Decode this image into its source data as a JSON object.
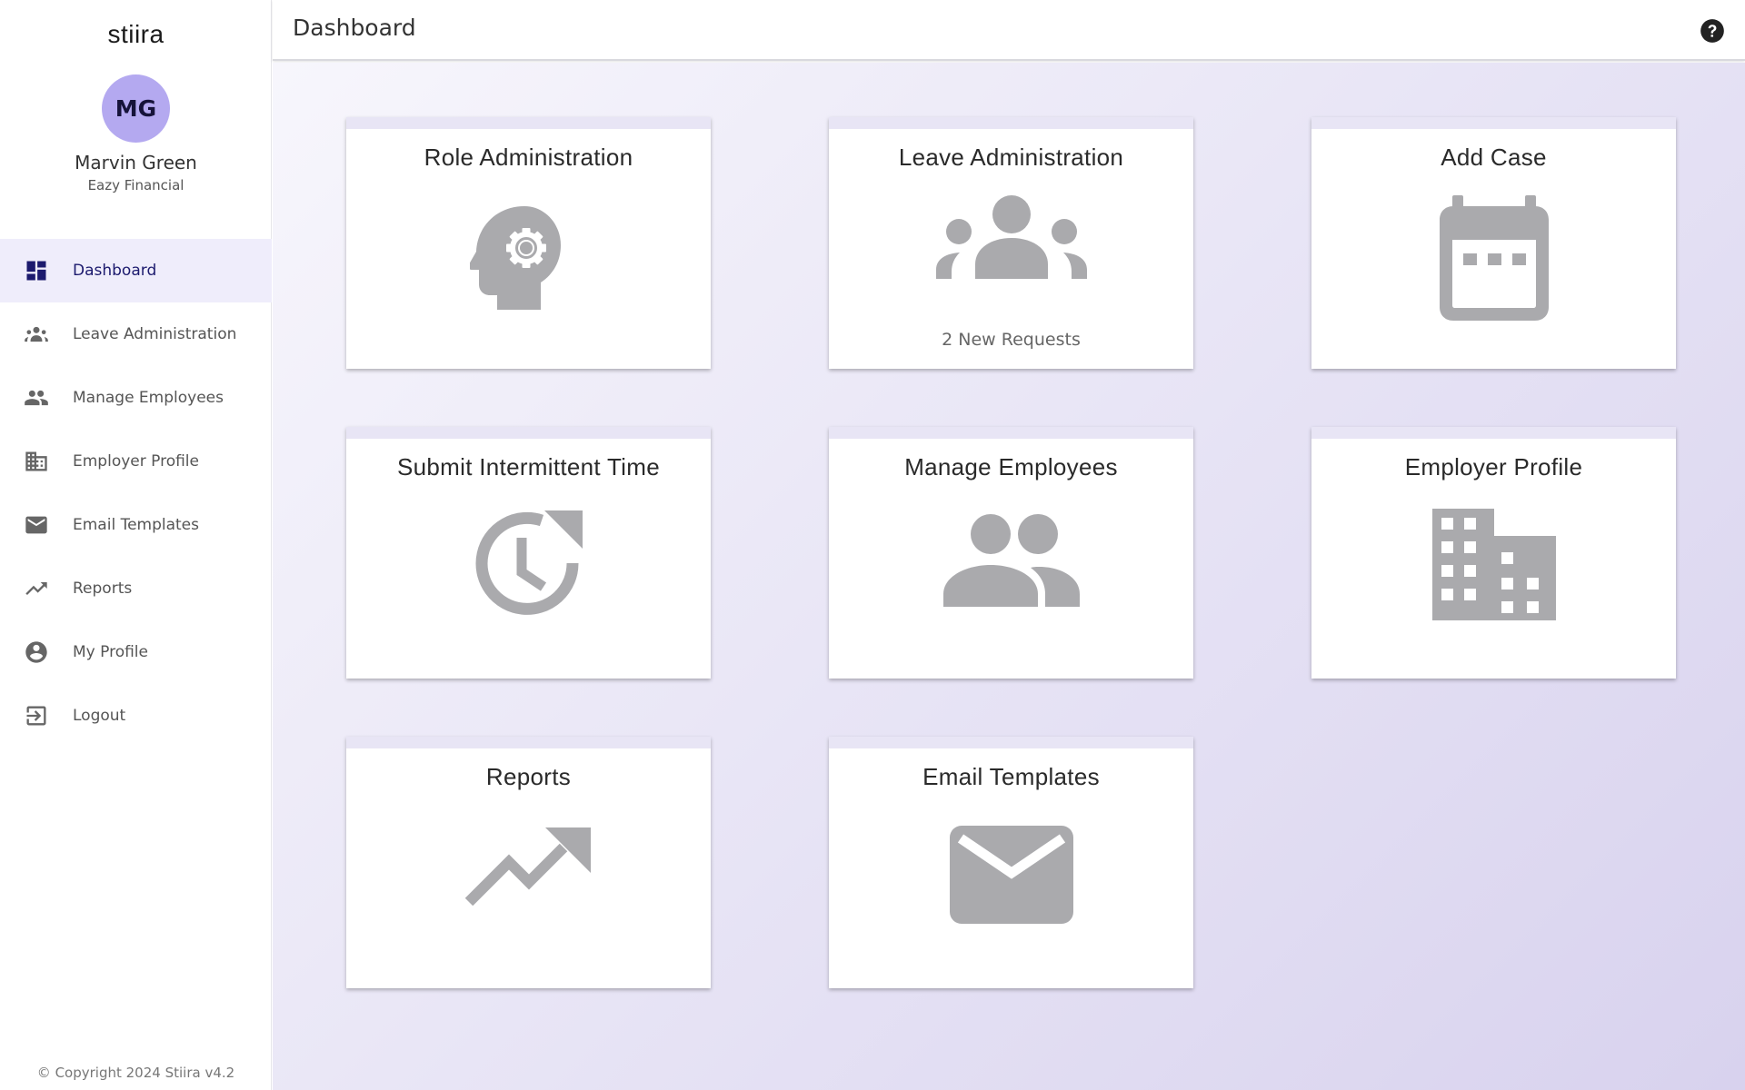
{
  "brand": {
    "logo_text": "stiira"
  },
  "user": {
    "initials": "MG",
    "name": "Marvin Green",
    "company": "Eazy Financial"
  },
  "nav": {
    "items": [
      {
        "label": "Dashboard",
        "icon": "dashboard-icon",
        "active": true
      },
      {
        "label": "Leave Administration",
        "icon": "groups-icon",
        "active": false
      },
      {
        "label": "Manage Employees",
        "icon": "people-icon",
        "active": false
      },
      {
        "label": "Employer Profile",
        "icon": "building-icon",
        "active": false
      },
      {
        "label": "Email Templates",
        "icon": "mail-icon",
        "active": false
      },
      {
        "label": "Reports",
        "icon": "trending-up-icon",
        "active": false
      },
      {
        "label": "My Profile",
        "icon": "account-circle-icon",
        "active": false
      },
      {
        "label": "Logout",
        "icon": "logout-icon",
        "active": false
      }
    ]
  },
  "footer": {
    "copyright": "Copyright 2024 Stiira v4.2"
  },
  "header": {
    "title": "Dashboard",
    "help_icon": "help-icon"
  },
  "cards": [
    {
      "title": "Role Administration",
      "icon": "psychology-gear-icon",
      "subtitle": ""
    },
    {
      "title": "Leave Administration",
      "icon": "groups-icon",
      "subtitle": "2 New Requests"
    },
    {
      "title": "Add Case",
      "icon": "calendar-icon",
      "subtitle": ""
    },
    {
      "title": "Submit Intermittent Time",
      "icon": "clock-refresh-icon",
      "subtitle": ""
    },
    {
      "title": "Manage Employees",
      "icon": "people-icon",
      "subtitle": ""
    },
    {
      "title": "Employer Profile",
      "icon": "building-icon",
      "subtitle": ""
    },
    {
      "title": "Reports",
      "icon": "trending-up-icon",
      "subtitle": ""
    },
    {
      "title": "Email Templates",
      "icon": "mail-icon",
      "subtitle": ""
    }
  ],
  "colors": {
    "accent": "#1c1a6e",
    "avatar_bg": "#b4a9f0",
    "active_nav_bg": "#efedfb",
    "icon_gray": "#aaaaad"
  }
}
